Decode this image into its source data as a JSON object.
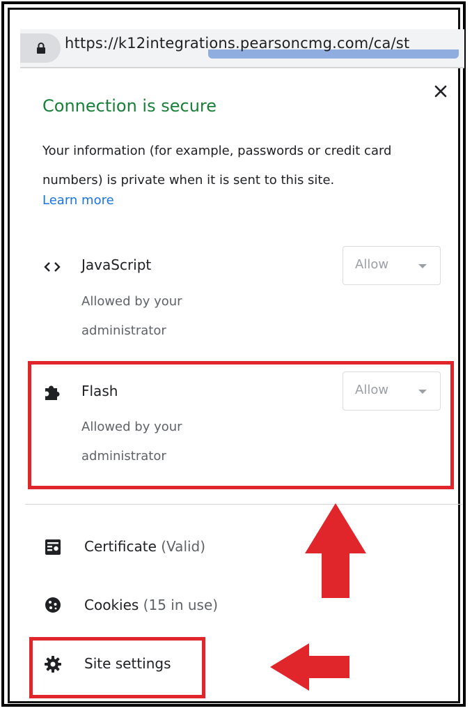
{
  "address_bar": {
    "url": "https://k12integrations.pearsoncmg.com/ca/st",
    "lock_icon": "lock-icon"
  },
  "site_info": {
    "close_icon": "close-icon",
    "title": "Connection is secure",
    "description": "Your information (for example, passwords or credit card numbers) is private when it is sent to this site.",
    "learn_more": "Learn more",
    "title_color": "#188038",
    "link_color": "#1a73e8"
  },
  "permissions": [
    {
      "icon": "code-icon",
      "label": "JavaScript",
      "sub": "Allowed by your administrator",
      "value": "Allow"
    },
    {
      "icon": "puzzle-piece-icon",
      "label": "Flash",
      "sub": "Allowed by your administrator",
      "value": "Allow"
    }
  ],
  "menu": {
    "certificate": {
      "icon": "certificate-icon",
      "label": "Certificate",
      "status": "(Valid)"
    },
    "cookies": {
      "icon": "cookie-icon",
      "label": "Cookies",
      "status": "(15 in use)"
    },
    "site_settings": {
      "icon": "gear-icon",
      "label": "Site settings"
    }
  },
  "annotations": {
    "highlight_color": "#e0252b",
    "up_arrow": "up-arrow-icon",
    "left_arrow": "left-arrow-icon"
  }
}
